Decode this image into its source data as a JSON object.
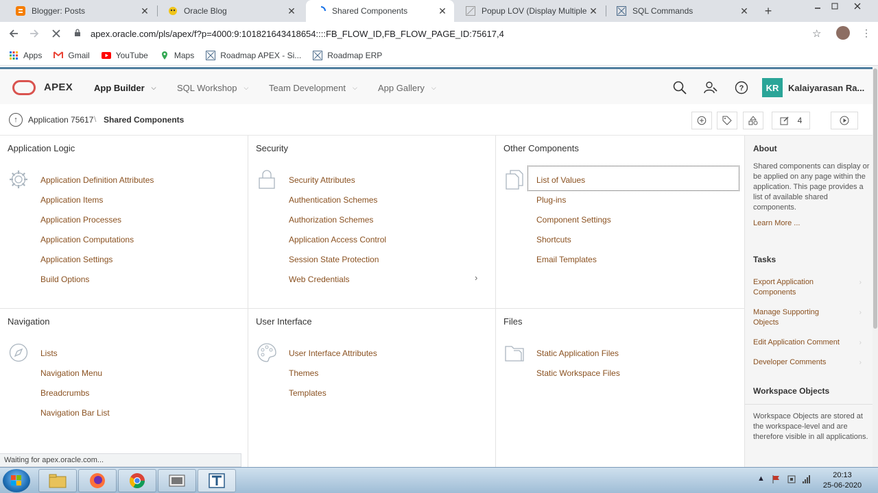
{
  "browser": {
    "tabs": [
      {
        "title": "Blogger: Posts",
        "icon": "blogger-icon"
      },
      {
        "title": "Oracle Blog",
        "icon": "oracle-blog-icon"
      },
      {
        "title": "Shared Components",
        "icon": "loading-spinner-icon"
      },
      {
        "title": "Popup LOV (Display Multiple Co",
        "icon": "apex-tab-icon"
      },
      {
        "title": "SQL Commands",
        "icon": "apex-tab-icon"
      }
    ],
    "url": "apex.oracle.com/pls/apex/f?p=4000:9:101821643418654::::FB_FLOW_ID,FB_FLOW_PAGE_ID:75617,4",
    "bookmarks": [
      {
        "label": "Apps",
        "icon": "apps-grid-icon"
      },
      {
        "label": "Gmail",
        "icon": "gmail-icon"
      },
      {
        "label": "YouTube",
        "icon": "youtube-icon"
      },
      {
        "label": "Maps",
        "icon": "maps-icon"
      },
      {
        "label": "Roadmap APEX - Si...",
        "icon": "apex-bookmark-icon"
      },
      {
        "label": "Roadmap ERP",
        "icon": "apex-bookmark-icon"
      }
    ],
    "status": "Waiting for apex.oracle.com..."
  },
  "header": {
    "logo": "APEX",
    "menus": [
      "App Builder",
      "SQL Workshop",
      "Team Development",
      "App Gallery"
    ],
    "avatar_initials": "KR",
    "user_name": "Kalaiyarasan Ra..."
  },
  "breadcrumb": {
    "parent": "Application 75617",
    "current": "Shared Components",
    "edit_count": "4"
  },
  "sections": {
    "app_logic": {
      "title": "Application Logic",
      "links": [
        "Application Definition Attributes",
        "Application Items",
        "Application Processes",
        "Application Computations",
        "Application Settings",
        "Build Options"
      ]
    },
    "security": {
      "title": "Security",
      "links": [
        "Security Attributes",
        "Authentication Schemes",
        "Authorization Schemes",
        "Application Access Control",
        "Session State Protection",
        "Web Credentials"
      ]
    },
    "other": {
      "title": "Other Components",
      "links": [
        "List of Values",
        "Plug-ins",
        "Component Settings",
        "Shortcuts",
        "Email Templates"
      ]
    },
    "navigation": {
      "title": "Navigation",
      "links": [
        "Lists",
        "Navigation Menu",
        "Breadcrumbs",
        "Navigation Bar List"
      ]
    },
    "ui": {
      "title": "User Interface",
      "links": [
        "User Interface Attributes",
        "Themes",
        "Templates"
      ]
    },
    "files": {
      "title": "Files",
      "links": [
        "Static Application Files",
        "Static Workspace Files"
      ]
    }
  },
  "sidebar": {
    "about_title": "About",
    "about_text": "Shared components can display or be applied on any page within the application. This page provides a list of available shared components.",
    "learn_more": "Learn More ...",
    "tasks_title": "Tasks",
    "tasks": [
      "Export Application Components",
      "Manage Supporting Objects",
      "Edit Application Comment",
      "Developer Comments"
    ],
    "workspace_title": "Workspace Objects",
    "workspace_text": "Workspace Objects are stored at the workspace-level and are therefore visible in all applications."
  },
  "taskbar": {
    "time": "20:13",
    "date": "25-06-2020"
  },
  "colors": {
    "link": "#8a5120",
    "header_bar": "#4f7e9e",
    "logo_red": "#d9534f",
    "avatar": "#2aa598"
  }
}
